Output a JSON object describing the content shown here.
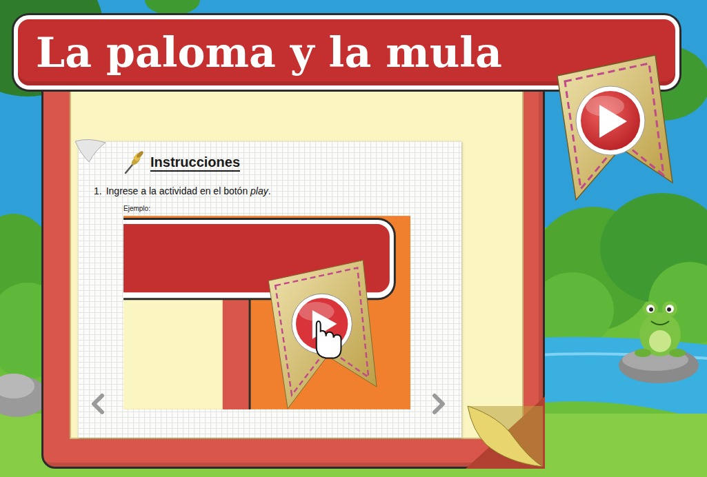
{
  "title": "La paloma y la mula",
  "instructions": {
    "heading": "Instrucciones",
    "steps": [
      {
        "number": "1.",
        "text": "Ingrese a la actividad en el botón ",
        "emphasis": "play",
        "end": "."
      }
    ],
    "example_label": "Ejemplo:"
  }
}
